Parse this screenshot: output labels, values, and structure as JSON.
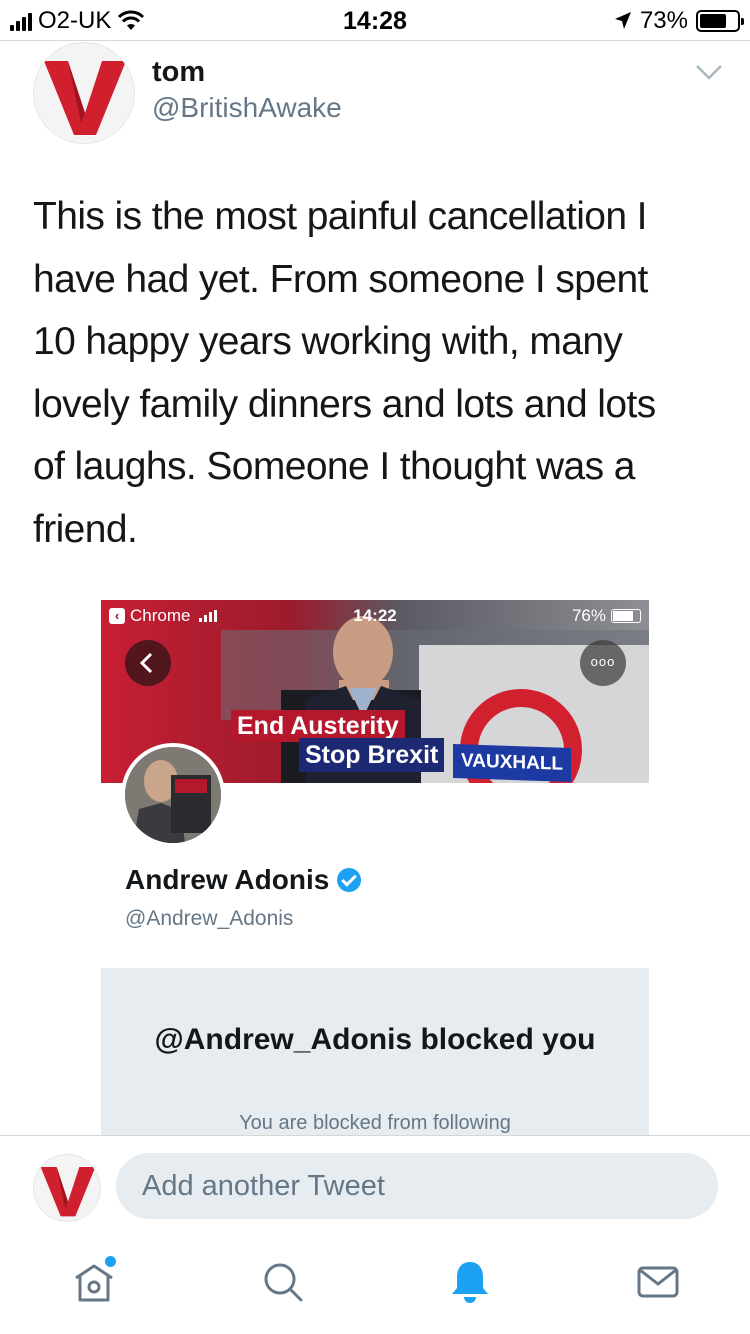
{
  "status_bar": {
    "carrier": "O2-UK",
    "time": "14:28",
    "battery": "73%",
    "battery_level": 0.73,
    "icons": [
      "signal-icon",
      "wifi-icon",
      "location-icon",
      "battery-icon"
    ]
  },
  "tweet": {
    "author_name": "tom",
    "author_handle": "@BritishAwake",
    "avatar_letter": "V",
    "lines": [
      "This is the most painful cancellation I",
      "have had yet. From someone I spent",
      "10 happy years working with, many",
      "lovely family dinners and lots and lots",
      "of laughs. Someone I thought was a",
      "friend."
    ]
  },
  "embedded_screenshot": {
    "status": {
      "back_app": "Chrome",
      "time": "14:22",
      "battery": "76%",
      "battery_level": 0.76
    },
    "more_label": "ooo",
    "banner": {
      "tag_1": "End Austerity",
      "tag_2": "Stop Brexit",
      "tag_3": "VAUXHALL"
    },
    "profile": {
      "name": "Andrew Adonis",
      "handle": "@Andrew_Adonis",
      "verified": true
    },
    "blocked": {
      "title": "@Andrew_Adonis blocked you",
      "subtitle": "You are blocked from following"
    }
  },
  "reply_bar": {
    "placeholder": "Add another Tweet",
    "avatar_letter": "V"
  },
  "tab_bar": {
    "tabs": [
      "home-icon",
      "search-icon",
      "notifications-icon",
      "messages-icon"
    ],
    "active": "notifications-icon",
    "colors": {
      "active": "#1da1f2",
      "inactive": "#657786"
    }
  },
  "colors": {
    "accent": "#1da1f2",
    "brand_red": "#d0202e",
    "text": "#14171a",
    "secondary": "#657786"
  }
}
